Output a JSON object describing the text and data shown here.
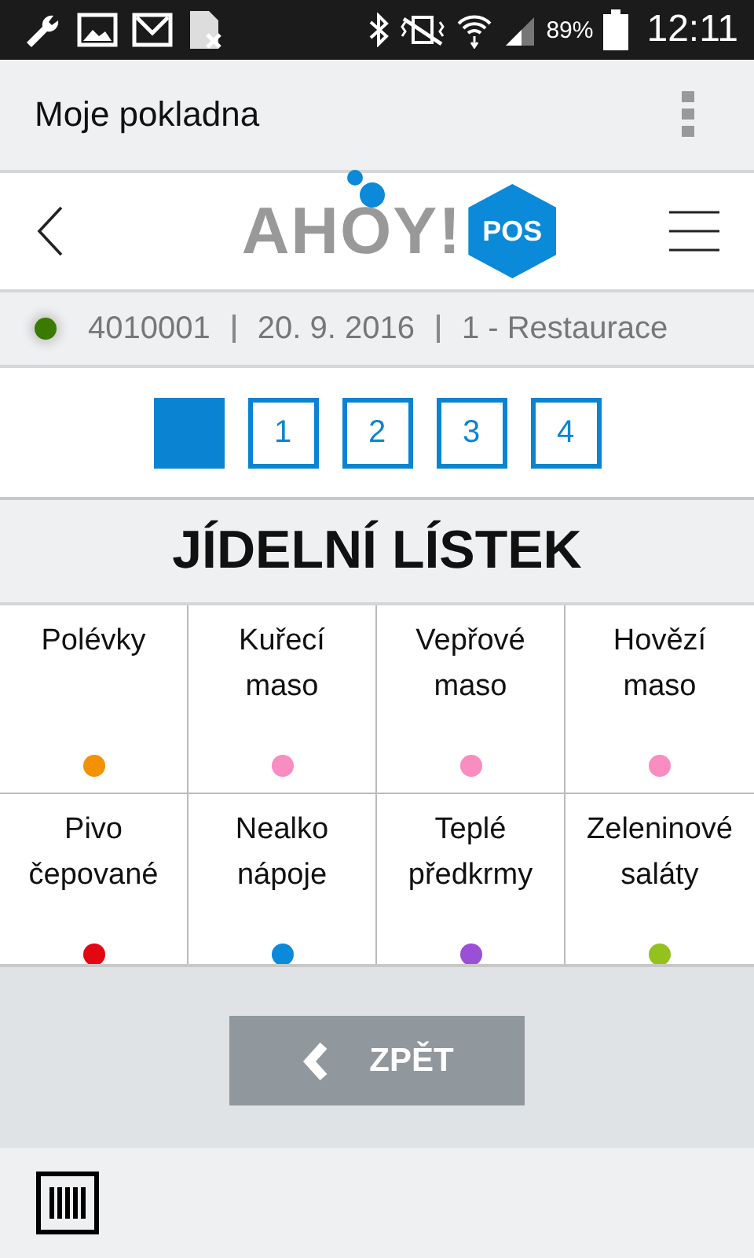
{
  "status_bar": {
    "battery": "89%",
    "time": "12:11"
  },
  "app_bar": {
    "title": "Moje pokladna"
  },
  "logo": {
    "text": "AHOY!",
    "badge": "POS"
  },
  "info": {
    "online": true,
    "register": "4010001",
    "date": "20. 9. 2016",
    "place": "1 - Restaurace"
  },
  "pages": [
    {
      "selected": true
    },
    {
      "label": "1",
      "selected": false
    },
    {
      "label": "2",
      "selected": false
    },
    {
      "label": "3",
      "selected": false
    },
    {
      "label": "4",
      "selected": false
    }
  ],
  "heading": "JÍDELNÍ LÍSTEK",
  "categories": [
    {
      "name": "Polévky",
      "color": "#f39200"
    },
    {
      "name": "Kuřecí maso",
      "color": "#f98cc0"
    },
    {
      "name": "Vepřové maso",
      "color": "#f98cc0"
    },
    {
      "name": "Hovězí maso",
      "color": "#f98cc0"
    },
    {
      "name": "Pivo čepované",
      "color": "#e30613"
    },
    {
      "name": "Nealko nápoje",
      "color": "#0a8ad8"
    },
    {
      "name": "Teplé předkrmy",
      "color": "#9b4fd6"
    },
    {
      "name": "Zeleninové saláty",
      "color": "#95c11f"
    }
  ],
  "back_button": "ZPĚT"
}
